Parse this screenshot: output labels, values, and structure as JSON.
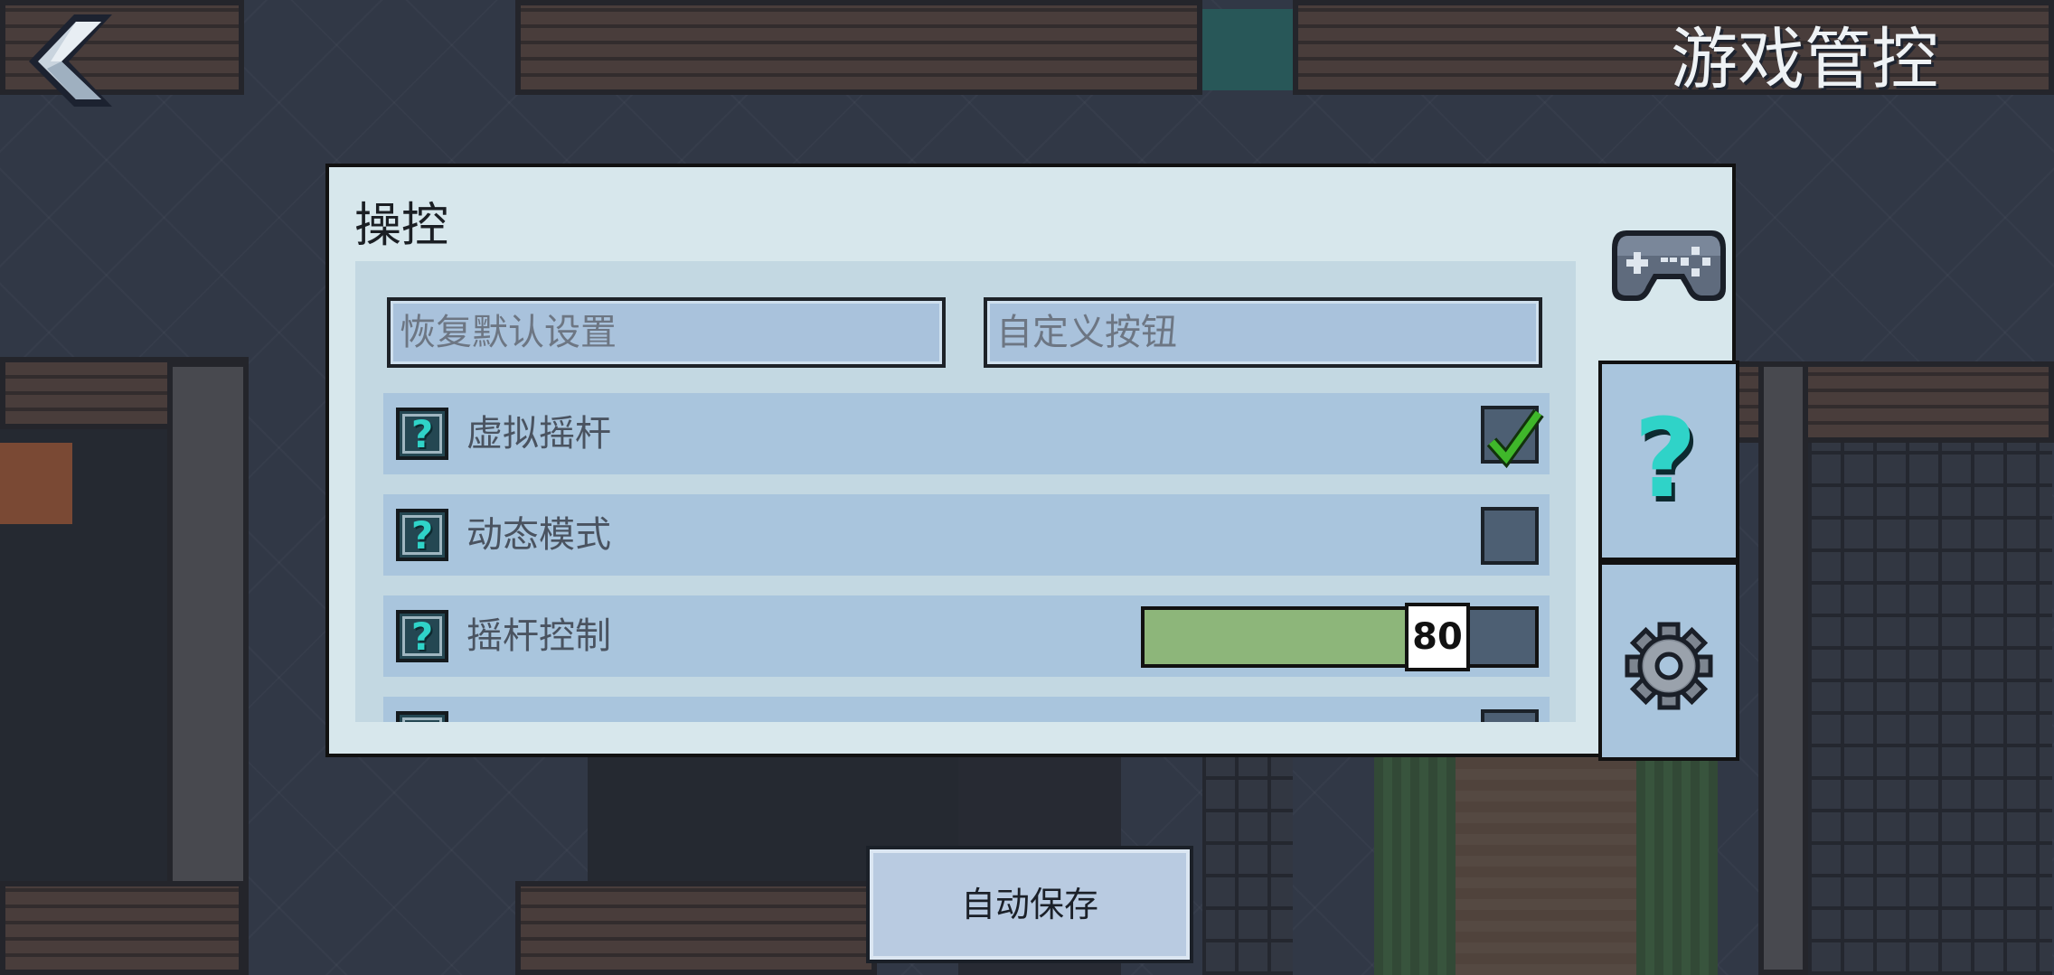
{
  "header": {
    "back_icon": "chevron-left-icon",
    "title": "游戏管控"
  },
  "dialog": {
    "title": "操控",
    "buttons": {
      "restore_defaults": "恢复默认设置",
      "custom_buttons": "自定义按钮"
    },
    "rows": [
      {
        "label": "虚拟摇杆",
        "type": "checkbox",
        "checked": true
      },
      {
        "label": "动态模式",
        "type": "checkbox",
        "checked": false
      },
      {
        "label": "摇杆控制",
        "type": "slider",
        "value": "80",
        "fraction": 0.8
      },
      {
        "type": "checkbox",
        "checked": false
      }
    ],
    "side_tabs": [
      {
        "icon": "controller-icon",
        "active": true
      },
      {
        "icon": "help-icon",
        "active": false
      },
      {
        "icon": "gear-icon",
        "active": false
      }
    ]
  },
  "footer": {
    "autosave": "自动保存"
  },
  "colors": {
    "dialog_bg": "#d7e7ec",
    "row_bg": "#a9c5dd",
    "slider_fill": "#8db67a",
    "check_green": "#3fb72a",
    "help_cyan": "#2fd3c8"
  }
}
